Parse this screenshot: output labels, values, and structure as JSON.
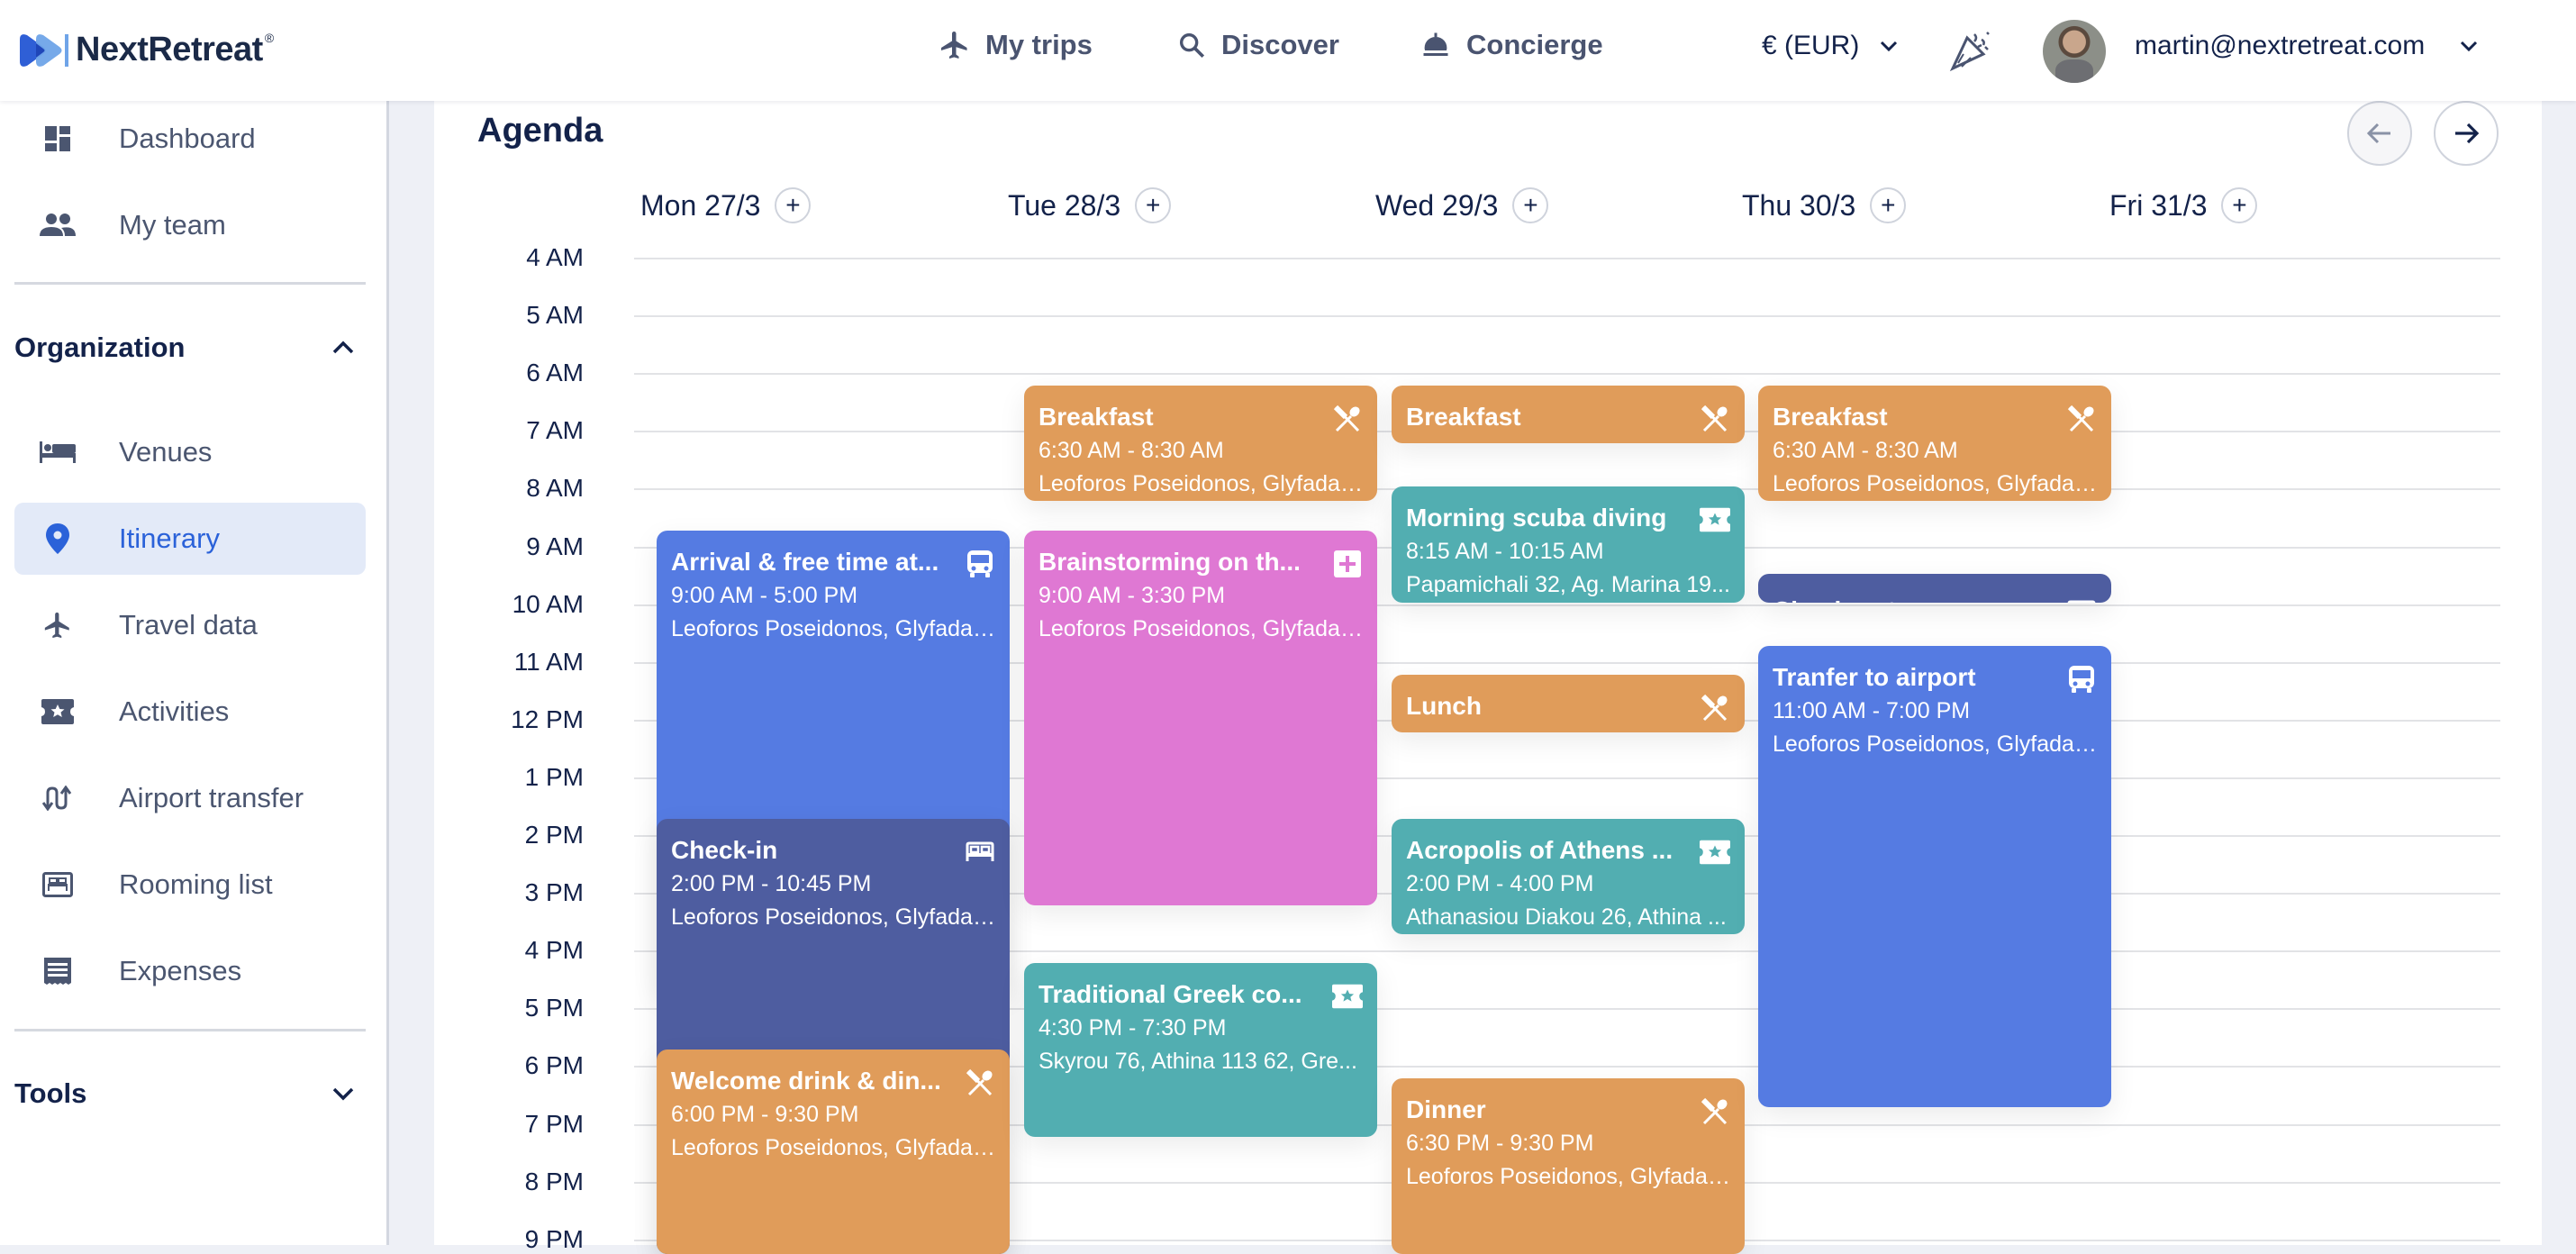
{
  "header": {
    "brand": "NextRetreat",
    "brand_mark": "®",
    "nav": [
      {
        "label": "My trips",
        "icon": "airplane-icon"
      },
      {
        "label": "Discover",
        "icon": "search-icon"
      },
      {
        "label": "Concierge",
        "icon": "concierge-bell-icon"
      }
    ],
    "currency": "€ (EUR)",
    "user_email": "martin@nextretreat.com"
  },
  "sidebar": {
    "top_items": [
      {
        "label": "Dashboard",
        "icon": "dashboard-icon"
      },
      {
        "label": "My team",
        "icon": "team-icon"
      }
    ],
    "organization": {
      "title": "Organization",
      "expanded": true,
      "items": [
        {
          "label": "Venues",
          "icon": "bed-icon"
        },
        {
          "label": "Itinerary",
          "icon": "map-pin-icon",
          "active": true
        },
        {
          "label": "Travel data",
          "icon": "airplane-icon"
        },
        {
          "label": "Activities",
          "icon": "ticket-star-icon"
        },
        {
          "label": "Airport transfer",
          "icon": "transfer-arrows-icon"
        },
        {
          "label": "Rooming list",
          "icon": "rooming-list-icon"
        },
        {
          "label": "Expenses",
          "icon": "receipt-icon"
        }
      ]
    },
    "tools": {
      "title": "Tools",
      "expanded": false
    }
  },
  "agenda": {
    "title": "Agenda",
    "days": [
      "Mon 27/3",
      "Tue 28/3",
      "Wed 29/3",
      "Thu 30/3",
      "Fri 31/3"
    ],
    "hours": [
      "4 AM",
      "5 AM",
      "6 AM",
      "7 AM",
      "8 AM",
      "9 AM",
      "10 AM",
      "11 AM",
      "12 PM",
      "1 PM",
      "2 PM",
      "3 PM",
      "4 PM",
      "5 PM",
      "6 PM",
      "7 PM",
      "8 PM",
      "9 PM"
    ],
    "colors": {
      "transport": "#557be2",
      "accommodation": "#4e5da0",
      "food": "#e09c5a",
      "meeting": "#df78d3",
      "activity": "#52aeb1"
    },
    "events": [
      {
        "day": 0,
        "title": "Arrival & free time at...",
        "time": "9:00 AM - 5:00 PM",
        "location": "Leoforos Poseidonos, Glyfada,...",
        "type": "transport",
        "icon": "bus-icon",
        "start": 9.0,
        "end": 17.0
      },
      {
        "day": 0,
        "title": "Check-in",
        "time": "2:00 PM - 10:45 PM",
        "location": "Leoforos Poseidonos, Glyfada,...",
        "type": "accommodation",
        "icon": "bed-outline-icon",
        "start": 14.0,
        "end": 22.75
      },
      {
        "day": 0,
        "title": "Welcome drink & din...",
        "time": "6:00 PM - 9:30 PM",
        "location": "Leoforos Poseidonos, Glyfada,...",
        "type": "food",
        "icon": "utensils-icon",
        "start": 18.0,
        "end": 21.5
      },
      {
        "day": 1,
        "title": "Breakfast",
        "time": "6:30 AM - 8:30 AM",
        "location": "Leoforos Poseidonos, Glyfada,...",
        "type": "food",
        "icon": "utensils-icon",
        "start": 6.5,
        "end": 8.5
      },
      {
        "day": 1,
        "title": "Brainstorming on th...",
        "time": "9:00 AM - 3:30 PM",
        "location": "Leoforos Poseidonos, Glyfada,...",
        "type": "meeting",
        "icon": "plus-box-icon",
        "start": 9.0,
        "end": 15.5
      },
      {
        "day": 1,
        "title": "Traditional Greek co...",
        "time": "4:30 PM - 7:30 PM",
        "location": "Skyrou 76, Athina 113 62, Gre...",
        "type": "activity",
        "icon": "ticket-star-icon",
        "start": 16.5,
        "end": 19.5
      },
      {
        "day": 2,
        "title": "Breakfast",
        "time": "",
        "location": "",
        "type": "food",
        "icon": "utensils-icon",
        "start": 6.5,
        "end": 7.5
      },
      {
        "day": 2,
        "title": "Morning scuba diving",
        "time": "8:15 AM - 10:15 AM",
        "location": "Papamichali 32, Ag. Marina 19...",
        "type": "activity",
        "icon": "ticket-star-icon",
        "start": 8.25,
        "end": 10.25
      },
      {
        "day": 2,
        "title": "Lunch",
        "time": "",
        "location": "",
        "type": "food",
        "icon": "utensils-icon",
        "start": 11.5,
        "end": 12.5
      },
      {
        "day": 2,
        "title": "Acropolis of Athens ...",
        "time": "2:00 PM - 4:00 PM",
        "location": "Athanasiou Diakou 26, Athina ...",
        "type": "activity",
        "icon": "ticket-star-icon",
        "start": 14.0,
        "end": 16.0
      },
      {
        "day": 2,
        "title": "Dinner",
        "time": "6:30 PM - 9:30 PM",
        "location": "Leoforos Poseidonos, Glyfada,...",
        "type": "food",
        "icon": "utensils-icon",
        "start": 18.5,
        "end": 21.5
      },
      {
        "day": 3,
        "title": "Breakfast",
        "time": "6:30 AM - 8:30 AM",
        "location": "Leoforos Poseidonos, Glyfada,...",
        "type": "food",
        "icon": "utensils-icon",
        "start": 6.5,
        "end": 8.5
      },
      {
        "day": 3,
        "title": "Check-out",
        "time": "",
        "location": "",
        "type": "accommodation",
        "icon": "bed-outline-icon",
        "start": 9.75,
        "end": 10.25
      },
      {
        "day": 3,
        "title": "Tranfer to airport",
        "time": "11:00 AM - 7:00 PM",
        "location": "Leoforos Poseidonos, Glyfada,...",
        "type": "transport",
        "icon": "bus-icon",
        "start": 11.0,
        "end": 19.0
      }
    ]
  }
}
